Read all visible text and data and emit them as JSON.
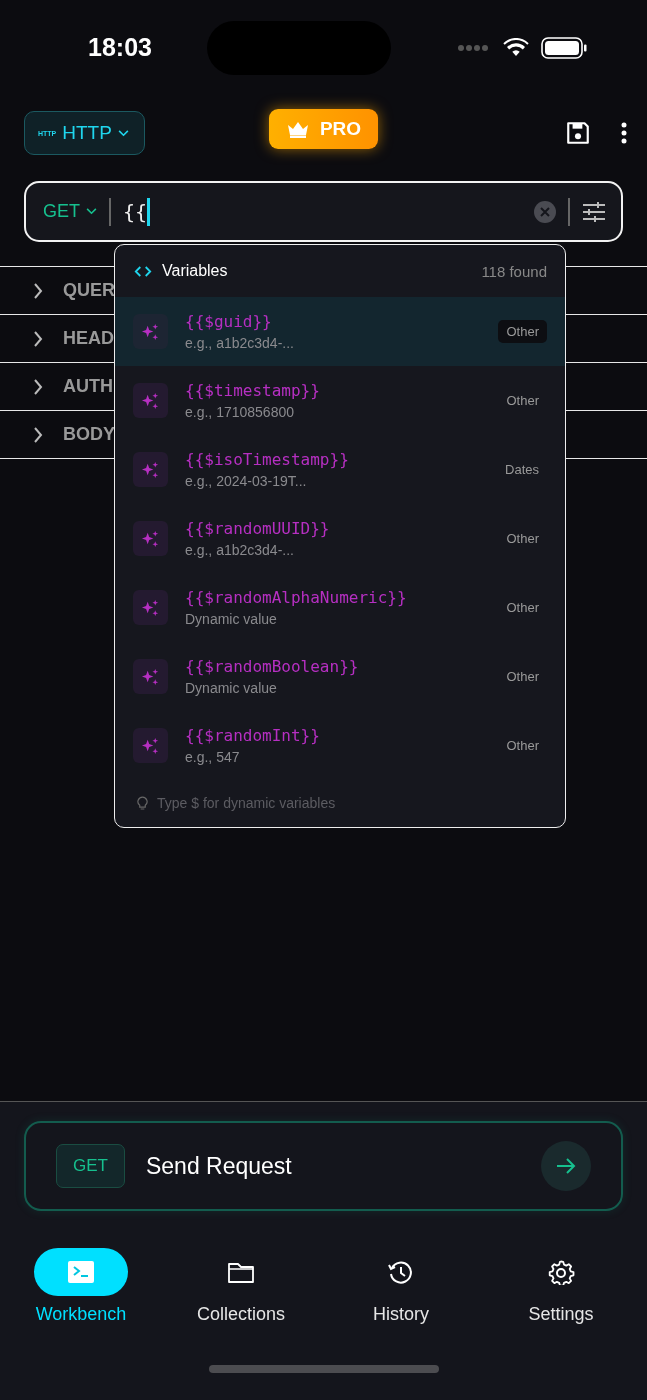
{
  "status_bar": {
    "time": "18:03"
  },
  "header": {
    "protocol_badge": "HTTP",
    "protocol": "HTTP",
    "pro": "PRO"
  },
  "url_bar": {
    "method": "GET",
    "value": "{{"
  },
  "sections": [
    {
      "label": "QUER",
      "expanded": false
    },
    {
      "label": "HEAD",
      "expanded": false
    },
    {
      "label": "AUTH",
      "expanded": false
    },
    {
      "label": "BODY",
      "expanded": false
    }
  ],
  "variables_popup": {
    "title": "Variables",
    "count": "118 found",
    "hint": "Type $ for dynamic variables",
    "items": [
      {
        "name": "{{$guid}}",
        "example": "e.g., a1b2c3d4-...",
        "category": "Other",
        "selected": true
      },
      {
        "name": "{{$timestamp}}",
        "example": "e.g., 1710856800",
        "category": "Other",
        "selected": false
      },
      {
        "name": "{{$isoTimestamp}}",
        "example": "e.g., 2024-03-19T...",
        "category": "Dates",
        "selected": false
      },
      {
        "name": "{{$randomUUID}}",
        "example": "e.g., a1b2c3d4-...",
        "category": "Other",
        "selected": false
      },
      {
        "name": "{{$randomAlphaNumeric}}",
        "example": "Dynamic value",
        "category": "Other",
        "selected": false
      },
      {
        "name": "{{$randomBoolean}}",
        "example": "Dynamic value",
        "category": "Other",
        "selected": false
      },
      {
        "name": "{{$randomInt}}",
        "example": "e.g., 547",
        "category": "Other",
        "selected": false
      }
    ]
  },
  "send_bar": {
    "method": "GET",
    "label": "Send Request"
  },
  "tabs": [
    {
      "label": "Workbench",
      "kind": "terminal",
      "selected": true
    },
    {
      "label": "Collections",
      "kind": "folder",
      "selected": false
    },
    {
      "label": "History",
      "kind": "history",
      "selected": false
    },
    {
      "label": "Settings",
      "kind": "gear",
      "selected": false
    }
  ]
}
